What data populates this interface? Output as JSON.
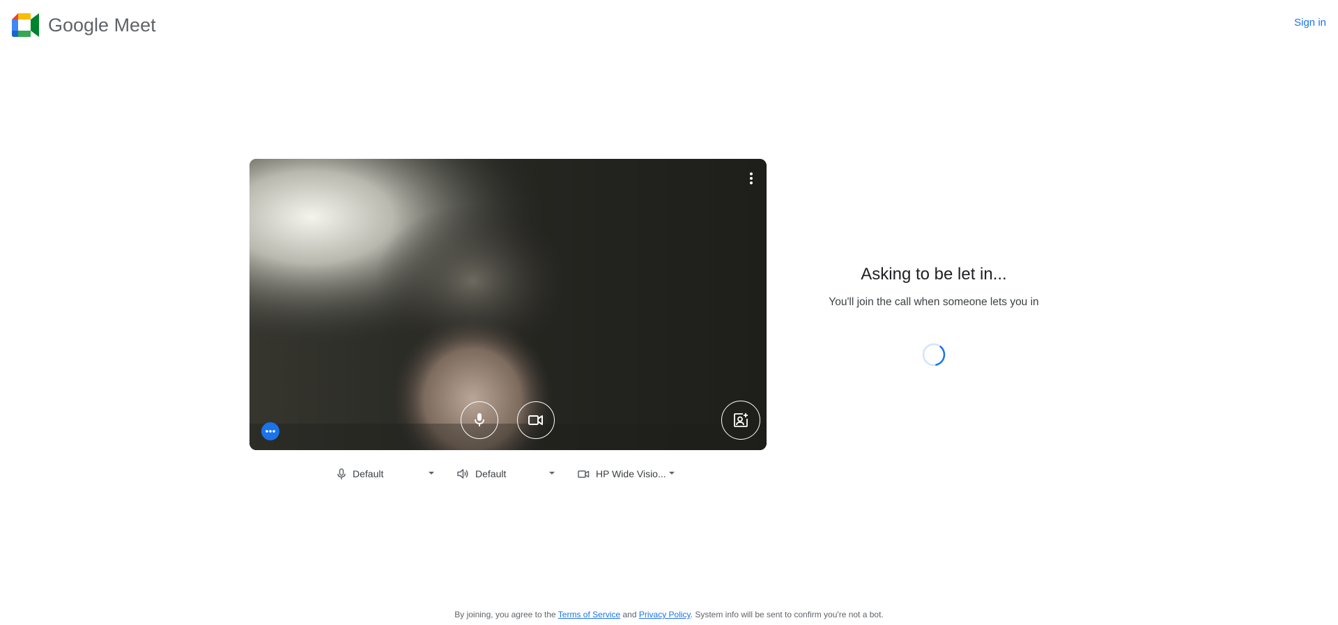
{
  "header": {
    "logo_text": "Google Meet",
    "sign_in_label": "Sign in"
  },
  "preview": {
    "more_options_icon": "more-vert-icon",
    "mic_icon": "microphone-icon",
    "camera_icon": "videocam-icon",
    "effects_icon": "more-horiz-icon",
    "portrait_icon": "portrait-add-icon"
  },
  "devices": {
    "microphone": {
      "icon": "microphone-icon",
      "selected": "Default"
    },
    "speaker": {
      "icon": "speaker-icon",
      "selected": "Default"
    },
    "camera": {
      "icon": "videocam-icon",
      "selected": "HP Wide Visio..."
    }
  },
  "status": {
    "title": "Asking to be let in...",
    "message": "You'll join the call when someone lets you in"
  },
  "footer": {
    "prefix": "By joining, you agree to the ",
    "terms_label": "Terms of Service",
    "middle": " and ",
    "privacy_label": "Privacy Policy",
    "suffix": ". System info will be sent to confirm you're not a bot."
  },
  "colors": {
    "accent": "#1a73e8",
    "text_primary": "#202124",
    "text_secondary": "#5f6368"
  }
}
